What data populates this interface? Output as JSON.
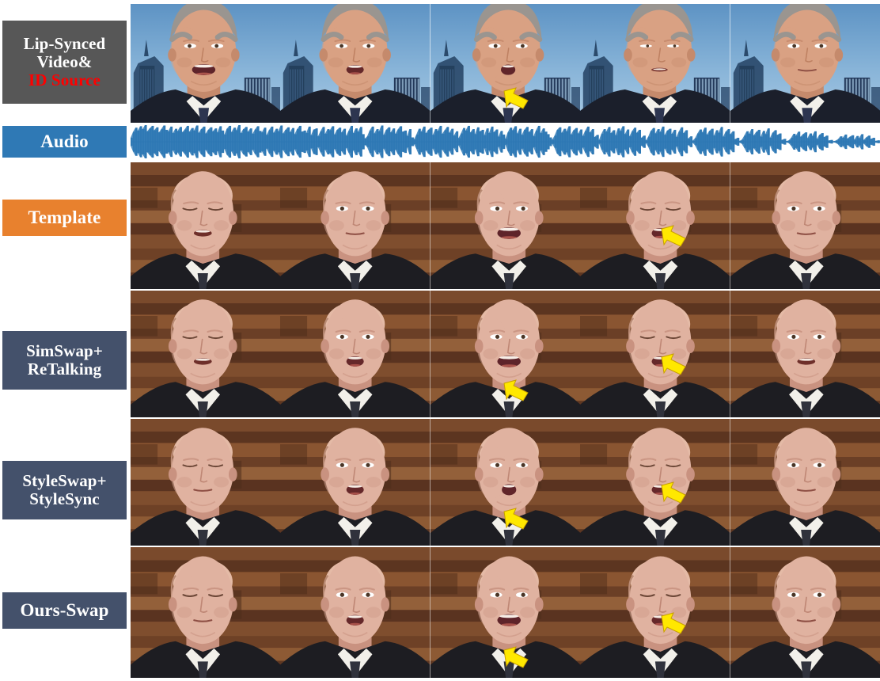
{
  "figure": {
    "type": "qualitative-comparison-grid",
    "columns": 5,
    "rows": 6,
    "accent_colors": {
      "source_label_bg": "#575757",
      "audio_label_bg": "#2F79B5",
      "template_label_bg": "#E8812E",
      "method_label_bg": "#44516B",
      "id_source_text": "#FF0000",
      "label_text": "#FFFFFF",
      "waveform": "#2F79B5",
      "marker": "#FFE800",
      "marker_outline": "#C8A000"
    }
  },
  "rows": [
    {
      "id": "lip-synced-video-id-source",
      "label_lines": [
        "Lip-Synced",
        "Video&",
        "ID Source"
      ],
      "label_line_colors": [
        "#FFFFFF",
        "#FFFFFF",
        "#FF0000"
      ],
      "label_bg": "#575757",
      "scene": "blue-sky-city-skyline",
      "subject": "man-grey-hair-dark-suit",
      "frames": [
        {
          "index": 1,
          "mouth": "open-wide",
          "eyes": "open",
          "head_turn": -2
        },
        {
          "index": 2,
          "mouth": "open-round",
          "eyes": "open",
          "head_turn": 0
        },
        {
          "index": 3,
          "mouth": "open-oval",
          "eyes": "open",
          "head_turn": 3
        },
        {
          "index": 4,
          "mouth": "closed-slight",
          "eyes": "half",
          "head_turn": 5
        },
        {
          "index": 5,
          "mouth": "closed",
          "eyes": "open",
          "head_turn": 2
        }
      ],
      "markers": [
        {
          "frame": 3,
          "x": 0.57,
          "y": 0.79
        }
      ]
    },
    {
      "id": "audio",
      "label_lines": [
        "Audio"
      ],
      "label_line_colors": [
        "#FFFFFF"
      ],
      "label_bg": "#2F79B5",
      "scene": "audio-waveform",
      "waveform_color": "#2F79B5",
      "frames": [],
      "markers": []
    },
    {
      "id": "template",
      "label_lines": [
        "Template"
      ],
      "label_line_colors": [
        "#FFFFFF"
      ],
      "label_bg": "#E8812E",
      "scene": "wood-panel-interior",
      "subject": "bald-man-dark-suit",
      "frames": [
        {
          "index": 1,
          "mouth": "open-small",
          "eyes": "closed",
          "head_turn": -3
        },
        {
          "index": 2,
          "mouth": "closed",
          "eyes": "open",
          "head_turn": 0
        },
        {
          "index": 3,
          "mouth": "open-wide",
          "eyes": "open",
          "head_turn": 4
        },
        {
          "index": 4,
          "mouth": "open-round",
          "eyes": "closed",
          "head_turn": 6
        },
        {
          "index": 5,
          "mouth": "closed",
          "eyes": "open",
          "head_turn": 1
        }
      ],
      "markers": [
        {
          "frame": 4,
          "x": 0.62,
          "y": 0.58
        }
      ]
    },
    {
      "id": "simswap-retalking",
      "label_lines": [
        "SimSwap+",
        "ReTalking"
      ],
      "label_line_colors": [
        "#FFFFFF",
        "#FFFFFF"
      ],
      "label_bg": "#44516B",
      "scene": "wood-panel-interior",
      "subject": "swapped-identity",
      "frames": [
        {
          "index": 1,
          "mouth": "open-small",
          "eyes": "closed",
          "head_turn": -3
        },
        {
          "index": 2,
          "mouth": "open-round",
          "eyes": "open",
          "head_turn": 0
        },
        {
          "index": 3,
          "mouth": "open-wide",
          "eyes": "open",
          "head_turn": 4
        },
        {
          "index": 4,
          "mouth": "open-round",
          "eyes": "closed",
          "head_turn": 6
        },
        {
          "index": 5,
          "mouth": "open-small",
          "eyes": "open",
          "head_turn": 1
        }
      ],
      "markers": [
        {
          "frame": 3,
          "x": 0.57,
          "y": 0.79
        },
        {
          "frame": 4,
          "x": 0.62,
          "y": 0.58
        }
      ]
    },
    {
      "id": "styleswap-stylesync",
      "label_lines": [
        "StyleSwap+",
        "StyleSync"
      ],
      "label_line_colors": [
        "#FFFFFF",
        "#FFFFFF"
      ],
      "label_bg": "#44516B",
      "scene": "wood-panel-interior",
      "subject": "swapped-identity",
      "frames": [
        {
          "index": 1,
          "mouth": "closed",
          "eyes": "closed",
          "head_turn": -3
        },
        {
          "index": 2,
          "mouth": "open-round",
          "eyes": "open",
          "head_turn": 0
        },
        {
          "index": 3,
          "mouth": "open-oval",
          "eyes": "open",
          "head_turn": 4
        },
        {
          "index": 4,
          "mouth": "open-round",
          "eyes": "closed",
          "head_turn": 6
        },
        {
          "index": 5,
          "mouth": "closed",
          "eyes": "open",
          "head_turn": 1
        }
      ],
      "markers": [
        {
          "frame": 3,
          "x": 0.57,
          "y": 0.79
        },
        {
          "frame": 4,
          "x": 0.62,
          "y": 0.58
        }
      ]
    },
    {
      "id": "ours-swap",
      "label_lines": [
        "Ours-Swap"
      ],
      "label_line_colors": [
        "#FFFFFF"
      ],
      "label_bg": "#44516B",
      "scene": "wood-panel-interior",
      "subject": "swapped-identity",
      "frames": [
        {
          "index": 1,
          "mouth": "closed",
          "eyes": "closed",
          "head_turn": -3
        },
        {
          "index": 2,
          "mouth": "open-round",
          "eyes": "open",
          "head_turn": 0
        },
        {
          "index": 3,
          "mouth": "open-wide",
          "eyes": "open",
          "head_turn": 4
        },
        {
          "index": 4,
          "mouth": "open-round",
          "eyes": "closed",
          "head_turn": 6
        },
        {
          "index": 5,
          "mouth": "closed",
          "eyes": "open",
          "head_turn": 1
        }
      ],
      "markers": [
        {
          "frame": 3,
          "x": 0.57,
          "y": 0.84
        },
        {
          "frame": 4,
          "x": 0.62,
          "y": 0.58
        }
      ]
    }
  ],
  "waveform": {
    "label": "Audio",
    "color": "#2F79B5",
    "samples": [
      0.22,
      0.55,
      0.78,
      0.62,
      0.86,
      0.7,
      0.92,
      0.58,
      0.74,
      0.88,
      0.64,
      0.8,
      0.52,
      0.7,
      0.9,
      0.66,
      0.58,
      0.84,
      0.48,
      0.72,
      0.6,
      0.82,
      0.54,
      0.68,
      0.88,
      0.56,
      0.76,
      0.62,
      0.9,
      0.5,
      0.7,
      0.84,
      0.46,
      0.66,
      0.8,
      0.58,
      0.74,
      0.52,
      0.86,
      0.62,
      0.4,
      0.72,
      0.88,
      0.54,
      0.78,
      0.64,
      0.92,
      0.48,
      0.7,
      0.82,
      0.56,
      0.74,
      0.44,
      0.68,
      0.86,
      0.6,
      0.52,
      0.78,
      0.38,
      0.64,
      0.84,
      0.5,
      0.72,
      0.58,
      0.9,
      0.46,
      0.66,
      0.8,
      0.54,
      0.76,
      0.42,
      0.7,
      0.88,
      0.56,
      0.62,
      0.48,
      0.84,
      0.36,
      0.68,
      0.74,
      0.3,
      0.58,
      0.82,
      0.44,
      0.7,
      0.64,
      0.86,
      0.4,
      0.66,
      0.78,
      0.52,
      0.72,
      0.34,
      0.6,
      0.88,
      0.48,
      0.74,
      0.56,
      0.82,
      0.42,
      0.18,
      0.3,
      0.62,
      0.84,
      0.46,
      0.7,
      0.58,
      0.9,
      0.38,
      0.66,
      0.8,
      0.52,
      0.74,
      0.44,
      0.68,
      0.86,
      0.56,
      0.62,
      0.32,
      0.7,
      0.24,
      0.14,
      0.4,
      0.72,
      0.56,
      0.84,
      0.48,
      0.66,
      0.78,
      0.38,
      0.7,
      0.6,
      0.88,
      0.44,
      0.64,
      0.82,
      0.5,
      0.72,
      0.34,
      0.58,
      0.2,
      0.46,
      0.76,
      0.62,
      0.88,
      0.52,
      0.7,
      0.42,
      0.8,
      0.58,
      0.66,
      0.36,
      0.74,
      0.48,
      0.84,
      0.54,
      0.68,
      0.28,
      0.6,
      0.4,
      0.16,
      0.52,
      0.78,
      0.64,
      0.86,
      0.46,
      0.72,
      0.38,
      0.66,
      0.82,
      0.54,
      0.7,
      0.3,
      0.62,
      0.88,
      0.48,
      0.74,
      0.56,
      0.42,
      0.24,
      0.12,
      0.34,
      0.66,
      0.8,
      0.5,
      0.72,
      0.58,
      0.86,
      0.4,
      0.64,
      0.76,
      0.46,
      0.68,
      0.32,
      0.6,
      0.84,
      0.52,
      0.7,
      0.26,
      0.38,
      0.1,
      0.44,
      0.7,
      0.56,
      0.82,
      0.48,
      0.64,
      0.36,
      0.74,
      0.6,
      0.86,
      0.42,
      0.68,
      0.3,
      0.58,
      0.78,
      0.5,
      0.66,
      0.22,
      0.34,
      0.08,
      0.28,
      0.6,
      0.76,
      0.46,
      0.7,
      0.54,
      0.84,
      0.38,
      0.62,
      0.72,
      0.44,
      0.66,
      0.26,
      0.56,
      0.8,
      0.48,
      0.64,
      0.18,
      0.3,
      0.06,
      0.2,
      0.46,
      0.68,
      0.52,
      0.78,
      0.4,
      0.6,
      0.72,
      0.34,
      0.64,
      0.5,
      0.82,
      0.28,
      0.56,
      0.7,
      0.42,
      0.58,
      0.14,
      0.22,
      0.05,
      0.12,
      0.34,
      0.58,
      0.44,
      0.7,
      0.36,
      0.54,
      0.66,
      0.28,
      0.6,
      0.42,
      0.74,
      0.22,
      0.5,
      0.64,
      0.38,
      0.46,
      0.1,
      0.16,
      0.04,
      0.08,
      0.22,
      0.44,
      0.34,
      0.56,
      0.28,
      0.42,
      0.52,
      0.2,
      0.46,
      0.32,
      0.58,
      0.16,
      0.38,
      0.48,
      0.26,
      0.34,
      0.07,
      0.1,
      0.03,
      0.06,
      0.14,
      0.3,
      0.22,
      0.4,
      0.18,
      0.28,
      0.36,
      0.12,
      0.32,
      0.2,
      0.42,
      0.1,
      0.24,
      0.34,
      0.16,
      0.22,
      0.05,
      0.08
    ]
  }
}
